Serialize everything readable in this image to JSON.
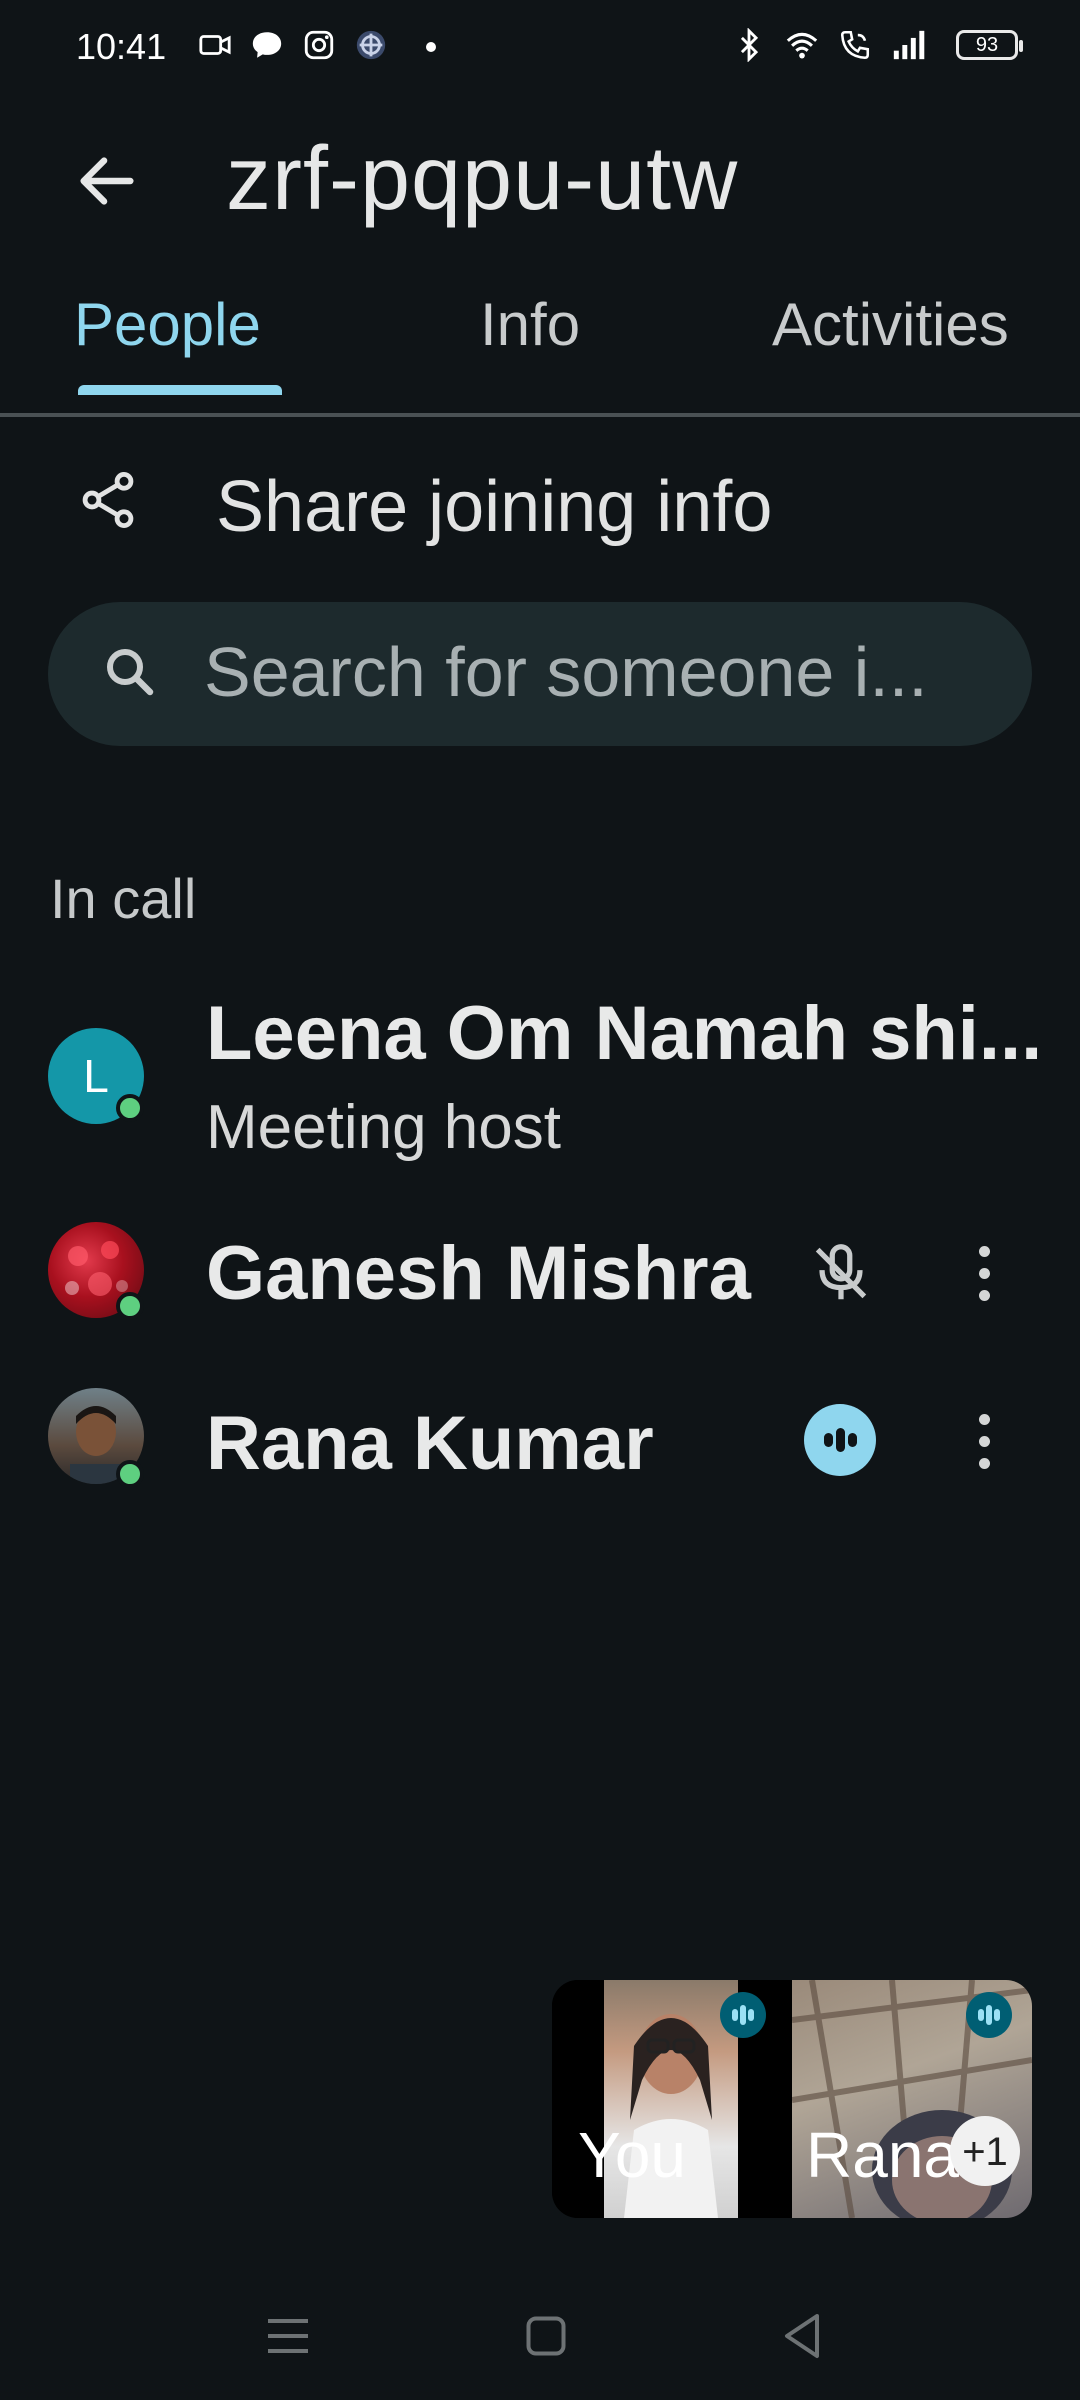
{
  "status_bar": {
    "time": "10:41",
    "battery": "93",
    "icons": [
      "video-camera-icon",
      "chat-bubble-icon",
      "instagram-icon",
      "app-icon",
      "dot-icon",
      "bluetooth-icon",
      "wifi-icon",
      "wifi-calling-icon",
      "signal-icon",
      "battery-icon"
    ]
  },
  "header": {
    "title": "zrf-pqpu-utw",
    "tabs": [
      {
        "label": "People",
        "active": true
      },
      {
        "label": "Info",
        "active": false
      },
      {
        "label": "Activities",
        "active": false
      }
    ]
  },
  "share": {
    "label": "Share joining info"
  },
  "search": {
    "placeholder": "Search for someone i..."
  },
  "section": {
    "title": "In call"
  },
  "participants": [
    {
      "name": "Leena Om Namah shi...",
      "subtitle": "Meeting host",
      "avatar_letter": "L",
      "avatar_color": "#1497a8",
      "status": "online"
    },
    {
      "name": "Ganesh Mishra",
      "status": "online",
      "audio": "muted"
    },
    {
      "name": "Rana Kumar",
      "status": "online",
      "audio": "speaking"
    }
  ],
  "pip": {
    "tiles": [
      {
        "label": "You"
      },
      {
        "label": "Rana"
      }
    ],
    "overflow": "+1"
  },
  "colors": {
    "accent": "#8fd6ee",
    "background": "#0f1417",
    "online": "#5ecf80",
    "speaking": "#8fd6ee"
  }
}
